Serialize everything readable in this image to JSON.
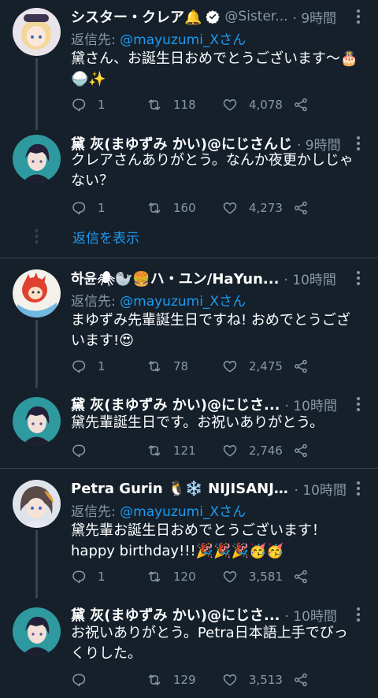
{
  "tweets": [
    {
      "name": "シスター・クレア🔔",
      "handle": "@Sister...",
      "time": "· 9時間",
      "reply_prefix": "返信先: ",
      "reply_mention": "@mayuzumi_Xさん",
      "text": "黛さん、お誕生日おめでとうございます〜🎂🍚✨",
      "replies": "1",
      "retweets": "118",
      "likes": "4,078",
      "verified": true
    },
    {
      "name": "黛 灰(まゆずみ かい)@にじさんじ",
      "time": "· 9時間",
      "text": "クレアさんありがとう。なんか夜更かしじゃない？",
      "replies": "1",
      "retweets": "160",
      "likes": "4,273"
    },
    {
      "name": "하윤🕷🦭🍔ハ・ユン/HaYun...",
      "time": "· 10時間",
      "reply_prefix": "返信先: ",
      "reply_mention": "@mayuzumi_Xさん",
      "text": "まゆずみ先輩誕生日ですね! おめでとうございます!😍",
      "replies": "1",
      "retweets": "78",
      "likes": "2,475"
    },
    {
      "name": "黛 灰(まゆずみ かい)@にじさ...",
      "time": "· 10時間",
      "text": "黛先輩誕生日です。お祝いありがとう。",
      "replies": "",
      "retweets": "121",
      "likes": "2,746"
    },
    {
      "name": "Petra Gurin 🐧❄️ NIJISANJI EN",
      "time": "· 10時間",
      "reply_prefix": "返信先: ",
      "reply_mention": "@mayuzumi_Xさん",
      "text": "黛先輩お誕生日おめでとうございます！\nhappy birthday!!!🎉🎉🎉🥳🥳",
      "replies": "1",
      "retweets": "120",
      "likes": "3,581"
    },
    {
      "name": "黛 灰(まゆずみ かい)@にじさ...",
      "time": "· 10時間",
      "text": "お祝いありがとう。Petra日本語上手でびっくりした。",
      "replies": "",
      "retweets": "129",
      "likes": "3,513"
    }
  ],
  "show_replies_label": "返信を表示",
  "colors": {
    "background": "#15202b",
    "text": "#ffffff",
    "secondary": "#8899a6",
    "link": "#1d9bf0",
    "divider": "#38444d"
  },
  "icons": {
    "reply": "reply-icon",
    "retweet": "retweet-icon",
    "like": "heart-icon",
    "share": "share-icon",
    "more": "more-icon",
    "verified": "verified-badge-icon"
  }
}
